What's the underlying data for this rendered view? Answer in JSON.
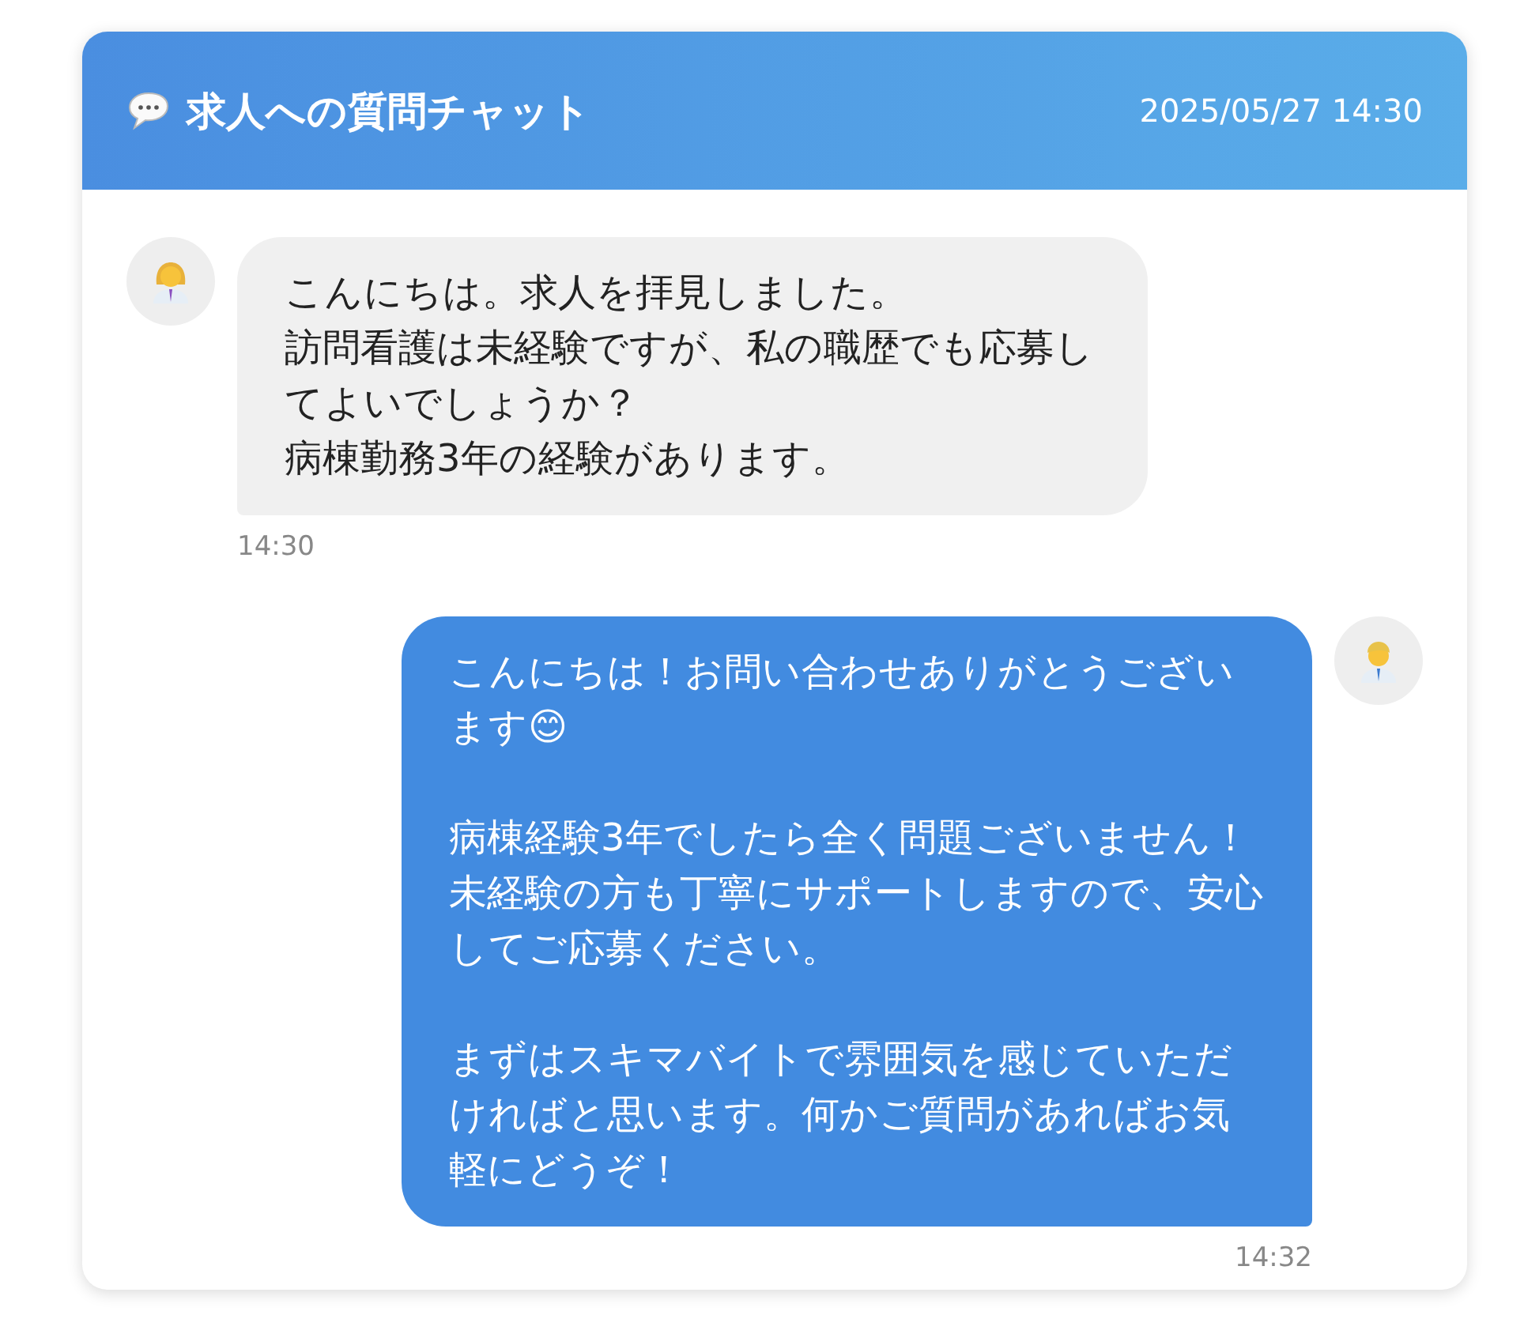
{
  "header": {
    "title": "求人への質問チャット",
    "datetime": "2025/05/27 14:30"
  },
  "messages": [
    {
      "kind": "received",
      "paragraphs": [
        {
          "lines": [
            "こんにちは。求人を拝見しました。",
            "訪問看護は未経験ですが、私の職歴でも応募してよいでしょうか？",
            "病棟勤務3年の経験があります。"
          ]
        }
      ],
      "time": "14:30"
    },
    {
      "kind": "sent",
      "paragraphs": [
        {
          "lines": [
            "こんにちは！お問い合わせありがとうございます😊"
          ]
        },
        {
          "lines": [
            "病棟経験3年でしたら全く問題ございません！",
            "未経験の方も丁寧にサポートしますので、安心してご応募ください。"
          ]
        },
        {
          "lines": [
            "まずはスキマバイトで雰囲気を感じていただければと思います。何かご質問があればお気軽にどうぞ！"
          ]
        }
      ],
      "time": "14:32"
    }
  ]
}
